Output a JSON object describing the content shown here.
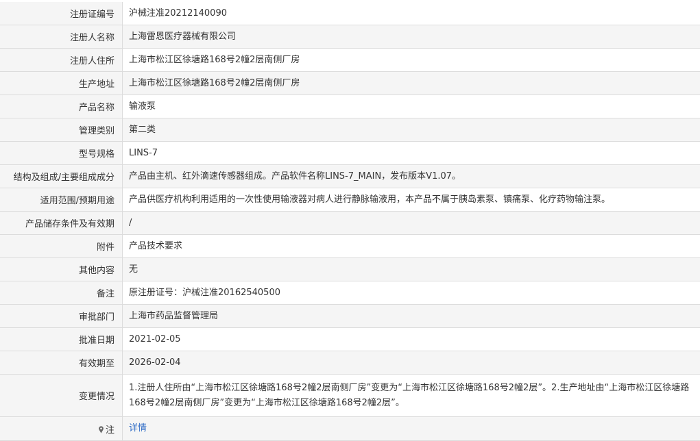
{
  "rows": [
    {
      "label": "注册证编号",
      "value": "沪械注准20212140090"
    },
    {
      "label": "注册人名称",
      "value": "上海雷恩医疗器械有限公司"
    },
    {
      "label": "注册人住所",
      "value": "上海市松江区徐塘路168号2幢2层南侧厂房"
    },
    {
      "label": "生产地址",
      "value": "上海市松江区徐塘路168号2幢2层南侧厂房"
    },
    {
      "label": "产品名称",
      "value": "输液泵"
    },
    {
      "label": "管理类别",
      "value": "第二类"
    },
    {
      "label": "型号规格",
      "value": "LINS-7"
    },
    {
      "label": "结构及组成/主要组成成分",
      "value": "产品由主机、红外滴速传感器组成。产品软件名称LINS-7_MAIN，发布版本V1.07。"
    },
    {
      "label": "适用范围/预期用途",
      "value": "产品供医疗机构利用适用的一次性使用输液器对病人进行静脉输液用，本产品不属于胰岛素泵、镇痛泵、化疗药物输注泵。"
    },
    {
      "label": "产品储存条件及有效期",
      "value": "/"
    },
    {
      "label": "附件",
      "value": "产品技术要求"
    },
    {
      "label": "其他内容",
      "value": "无"
    },
    {
      "label": "备注",
      "value": "原注册证号：沪械注准20162540500"
    },
    {
      "label": "审批部门",
      "value": "上海市药品监督管理局"
    },
    {
      "label": "批准日期",
      "value": "2021-02-05"
    },
    {
      "label": "有效期至",
      "value": "2026-02-04"
    },
    {
      "label": "变更情况",
      "value": "1.注册人住所由“上海市松江区徐塘路168号2幢2层南侧厂房”变更为“上海市松江区徐塘路168号2幢2层”。2.生产地址由“上海市松江区徐塘路168号2幢2层南侧厂房”变更为“上海市松江区徐塘路168号2幢2层”。"
    }
  ],
  "note_row": {
    "label": "注",
    "icon": "pin-icon",
    "link_text": "详情",
    "link_color": "#2e6bc6"
  },
  "colors": {
    "label_bg": "#f5f5f5",
    "border": "#dcdcdc",
    "text": "#333333"
  }
}
